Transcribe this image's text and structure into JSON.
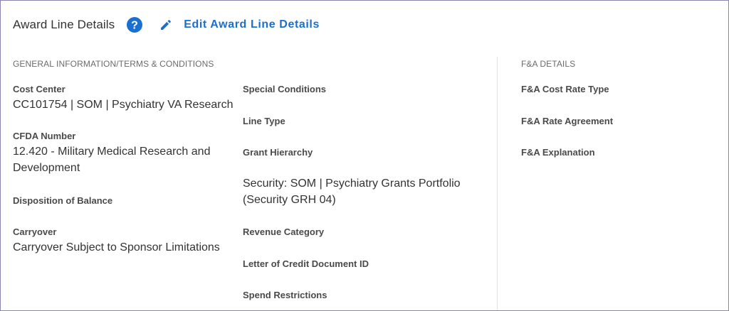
{
  "header": {
    "title": "Award Line Details",
    "help_icon": "help-circle-icon",
    "edit_icon": "pencil-icon",
    "edit_label": "Edit Award Line Details",
    "accent_color": "#1a6fd0"
  },
  "general": {
    "heading": "GENERAL INFORMATION/TERMS & CONDITIONS",
    "cost_center": {
      "label": "Cost Center",
      "value": "CC101754 | SOM | Psychiatry VA Research"
    },
    "cfda_number": {
      "label": "CFDA Number",
      "value_line1": "12.420 - Military Medical Research and",
      "value_line2": "Development"
    },
    "disposition_of_balance": {
      "label": "Disposition of Balance"
    },
    "carryover": {
      "label": "Carryover",
      "value": "Carryover Subject to Sponsor Limitations"
    },
    "special_conditions": {
      "label": "Special Conditions"
    },
    "line_type": {
      "label": "Line Type"
    },
    "grant_hierarchy": {
      "label": "Grant Hierarchy",
      "value_line1": "Security: SOM | Psychiatry Grants Portfolio",
      "value_line2": "(Security GRH 04)"
    },
    "revenue_category": {
      "label": "Revenue Category"
    },
    "letter_of_credit": {
      "label": "Letter of Credit Document ID"
    },
    "spend_restrictions": {
      "label": "Spend Restrictions"
    }
  },
  "fa_details": {
    "heading": "F&A DETAILS",
    "cost_rate_type": {
      "label": "F&A Cost Rate Type"
    },
    "rate_agreement": {
      "label": "F&A Rate Agreement"
    },
    "explanation": {
      "label": "F&A Explanation"
    }
  }
}
